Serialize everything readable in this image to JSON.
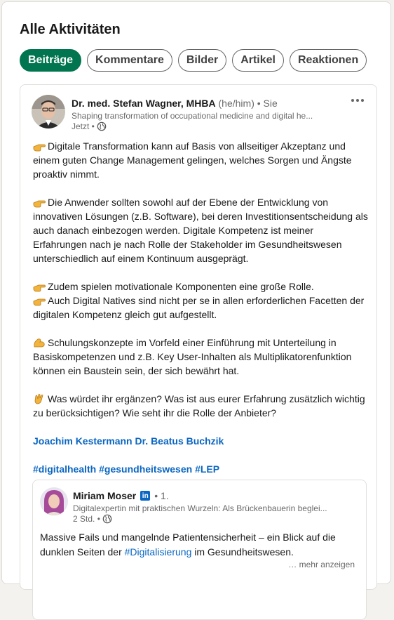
{
  "section": {
    "title": "Alle Aktivitäten"
  },
  "filters": [
    {
      "label": "Beiträge",
      "active": true
    },
    {
      "label": "Kommentare",
      "active": false
    },
    {
      "label": "Bilder",
      "active": false
    },
    {
      "label": "Artikel",
      "active": false
    },
    {
      "label": "Reaktionen",
      "active": false
    }
  ],
  "post": {
    "author": {
      "name": "Dr. med. Stefan Wagner, MHBA",
      "pronouns": "(he/him)",
      "degree": "• Sie",
      "headline": "Shaping transformation of occupational medicine and digital he...",
      "time": "Jetzt •",
      "visibility_icon": "globe-icon"
    },
    "more_icon": "more-horizontal-icon",
    "paragraphs": [
      {
        "lines": [
          {
            "emoji": "pointing-hand",
            "text": "Digitale Transformation kann auf Basis von allseitiger Akzeptanz und"
          },
          {
            "text": "einem guten Change Management gelingen, welches Sorgen und Ängste"
          },
          {
            "text": "proaktiv nimmt."
          }
        ]
      },
      {
        "lines": [
          {
            "emoji": "pointing-hand",
            "text": "Die Anwender sollten sowohl auf der Ebene der Entwicklung von"
          },
          {
            "text": "innovativen Lösungen (z.B. Software), bei deren Investitionsentscheidung als"
          },
          {
            "text": "auch danach einbezogen werden. Digitale Kompetenz ist meiner"
          },
          {
            "text": "Erfahrungen nach je nach Rolle der Stakeholder im Gesundheitswesen"
          },
          {
            "text": "unterschiedlich auf einem Kontinuum ausgeprägt."
          }
        ]
      },
      {
        "lines": [
          {
            "emoji": "pointing-hand",
            "text": "Zudem spielen motivationale Komponenten eine große Rolle."
          },
          {
            "emoji": "pointing-hand",
            "text": "Auch Digital Natives sind nicht per se in allen erforderlichen Facetten der"
          },
          {
            "text": "digitalen Kompetenz gleich gut aufgestellt."
          }
        ]
      },
      {
        "lines": [
          {
            "emoji": "flexed-biceps",
            "text": "Schulungskonzepte im Vorfeld einer Einführung mit Unterteilung in"
          },
          {
            "text": "Basiskompetenzen und z.B. Key User-Inhalten als Multiplikatorenfunktion"
          },
          {
            "text": "können ein Baustein sein, der sich bewährt hat."
          }
        ]
      },
      {
        "lines": [
          {
            "emoji": "waving-hand",
            "text": "Was würdet ihr ergänzen? Was ist aus eurer Erfahrung zusätzlich wichtig"
          },
          {
            "text": "zu berücksichtigen? Wie seht ihr die Rolle der Anbieter?"
          }
        ]
      }
    ],
    "mentions": [
      "Joachim Kestermann",
      "Dr. Beatus Buchzik"
    ],
    "hashtags": [
      "#digitalhealth",
      "#gesundheitswesen",
      "#LEP"
    ],
    "shared": {
      "author": "Miriam Moser",
      "badge": "in",
      "degree": "• 1.",
      "headline": "Digitalexpertin mit praktischen Wurzeln: Als Brückenbauerin beglei...",
      "time": "2 Std. •",
      "text_before": "Massive Fails und mangelnde Patientensicherheit – ein Blick auf die",
      "text_line2_before": "dunklen Seiten der ",
      "hashtag": "#Digitalisierung",
      "text_after": " im Gesundheitswesen.",
      "show_more": "… mehr anzeigen"
    }
  },
  "colors": {
    "accent_green": "#01754f",
    "link_blue": "#0a66c2"
  }
}
